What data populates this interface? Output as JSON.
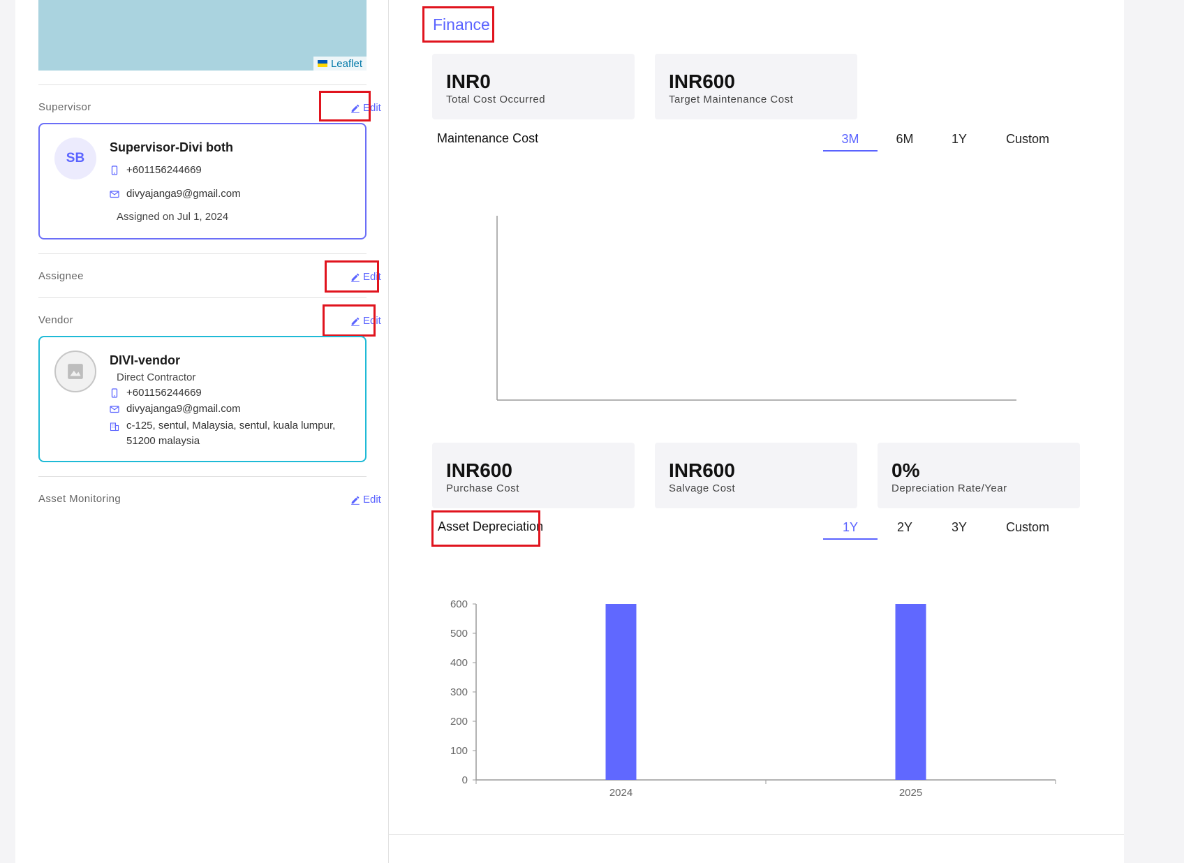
{
  "map": {
    "attribution": "Leaflet"
  },
  "supervisor": {
    "label": "Supervisor",
    "edit_label": "Edit",
    "initials": "SB",
    "name": "Supervisor-Divi both",
    "phone": "+601156244669",
    "email": "divyajanga9@gmail.com",
    "assigned": "Assigned on Jul 1, 2024"
  },
  "assignee": {
    "label": "Assignee",
    "edit_label": "Edit"
  },
  "vendor": {
    "label": "Vendor",
    "edit_label": "Edit",
    "name": "DIVI-vendor",
    "type": "Direct Contractor",
    "phone": "+601156244669",
    "email": "divyajanga9@gmail.com",
    "address_line1": "c-125, sentul, Malaysia, sentul, kuala lumpur,",
    "address_line2": "51200 malaysia"
  },
  "asset_monitoring": {
    "label": "Asset Monitoring",
    "edit_label": "Edit"
  },
  "finance": {
    "title": "Finance",
    "maintenance_stats": [
      {
        "value": "INR0",
        "label": "Total Cost Occurred"
      },
      {
        "value": "INR600",
        "label": "Target Maintenance Cost"
      }
    ],
    "maintenance_chart": {
      "title": "Maintenance Cost",
      "tabs": [
        "3M",
        "6M",
        "1Y",
        "Custom"
      ],
      "active_tab": "3M"
    },
    "depreciation_stats": [
      {
        "value": "INR600",
        "label": "Purchase Cost"
      },
      {
        "value": "INR600",
        "label": "Salvage Cost"
      },
      {
        "value": "0%",
        "label": "Depreciation Rate/Year"
      }
    ],
    "depreciation_chart": {
      "title": "Asset Depreciation",
      "tabs": [
        "1Y",
        "2Y",
        "3Y",
        "Custom"
      ],
      "active_tab": "1Y"
    }
  },
  "colors": {
    "accent": "#5a63ff",
    "bar": "#6068ff",
    "highlight": "#e0141e"
  },
  "chart_data": [
    {
      "type": "line",
      "title": "Maintenance Cost",
      "x": [],
      "series": [],
      "grid": false
    },
    {
      "type": "bar",
      "title": "Asset Depreciation",
      "categories": [
        "2024",
        "2025"
      ],
      "values": [
        600,
        600
      ],
      "yticks": [
        0,
        100,
        200,
        300,
        400,
        500,
        600
      ],
      "ylim": [
        0,
        600
      ],
      "grid": false
    }
  ]
}
